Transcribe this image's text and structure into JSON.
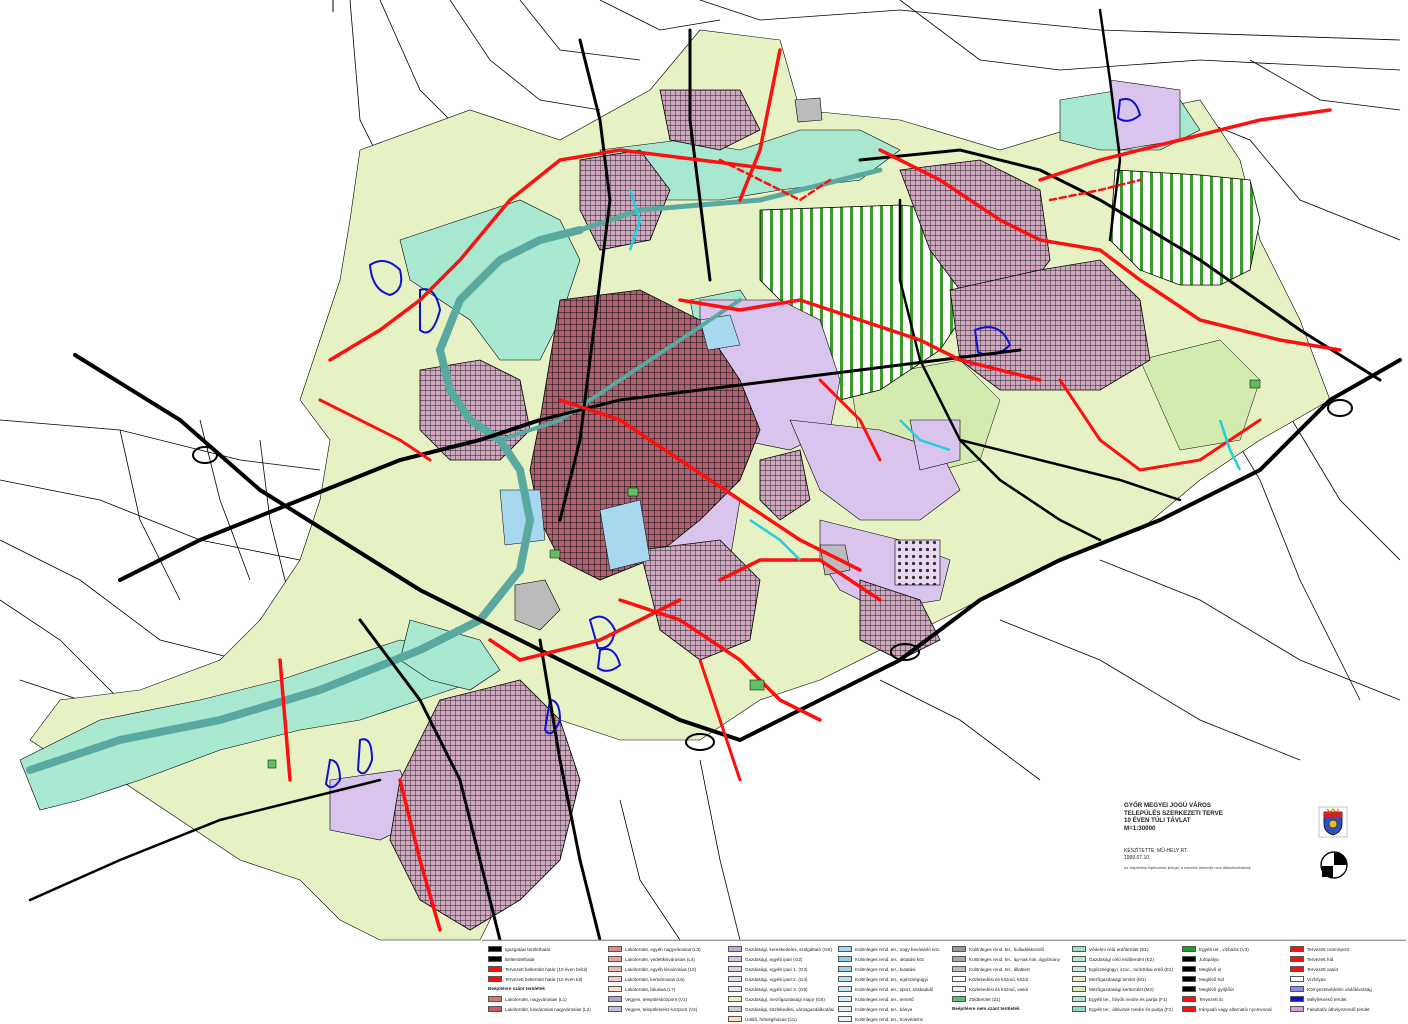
{
  "title": {
    "lines": [
      "GYŐR MEGYEI JOGÚ VÁROS",
      "TELEPÜLÉS SZERKEZETI TERVE",
      "10 ÉVEN TÚLI TÁVLAT",
      "M=1:30000"
    ],
    "maker": "KÉSZÍTETTE: MŰ-HELY RT.",
    "date": "1999.07.10.",
    "note": "Az alaptérkép tájékoztató jellegű, a méretek átmérője nem állandósíthatóak"
  },
  "colors": {
    "residential": "#e8a0a8",
    "residential_dark": "#c8606a",
    "mixed": "#c9b8e8",
    "industry": "#d8c4ec",
    "green": "#9fe0c0",
    "water_zone": "#a8e8d0",
    "agri": "#e6f2c4",
    "agri_dark": "#d4ebb0",
    "forest_stripe": "#3a9a2a",
    "road_plan": "#ff1010",
    "road": "#000000",
    "river": "#5aa9a0",
    "boundary_blue": "#1010d0",
    "special": "#a8d8f0"
  },
  "legend": {
    "col1": [
      {
        "label": "Igazgatási területhatár",
        "swatch": "#000000"
      },
      {
        "label": "Belterülethatár",
        "swatch": "#000000"
      },
      {
        "label": "Tervezett belterület határ (10 éven belül)",
        "swatch": "#ff1010"
      },
      {
        "label": "Tervezett belterület határ (10 éven túl)",
        "swatch": "#ff1010"
      }
    ],
    "col1_head": "Beépítésre szánt területek",
    "col1b": [
      {
        "label": "Lakóterület, nagyvárosias (L1)",
        "swatch": "#e07078"
      },
      {
        "label": "Lakóterület, kisvárosias nagyvárosias (L2)",
        "swatch": "#d05860"
      }
    ],
    "col2": [
      {
        "label": "Lakóterület, egyéb nagyvárosias (L3)",
        "swatch": "#e88888"
      },
      {
        "label": "Lakóterület, védettkisvárosias (L4)",
        "swatch": "#f0a0a0"
      },
      {
        "label": "Lakóterület, egyéb kisvárosias (L5)",
        "swatch": "#f4b4b4"
      },
      {
        "label": "Lakóterület, kertvárosias (L6)",
        "swatch": "#f8c8c8"
      },
      {
        "label": "Lakóterület, falusias (L7)",
        "swatch": "#fce0c8"
      },
      {
        "label": "Vegyes, településközpont (V1)",
        "swatch": "#b0a0d8"
      },
      {
        "label": "Vegyes, településrész-központ (V2)",
        "swatch": "#c4b8e4"
      }
    ],
    "col3": [
      {
        "label": "Gazdasági, kereskedelmi, szolgáltató (GK)",
        "swatch": "#c8a8e0"
      },
      {
        "label": "Gazdasági, egyéb ipari (G2)",
        "swatch": "#d8c0ec"
      },
      {
        "label": "Gazdasági, egyéb ipari 1. (G3)",
        "swatch": "#e0ccf0"
      },
      {
        "label": "Gazdasági, egyéb ipari 2. (G4)",
        "swatch": "#e8d8f4"
      },
      {
        "label": "Gazdasági, egyéb ipari 3. (G5)",
        "swatch": "#f0e4f8"
      },
      {
        "label": "Gazdasági, mezőgazdasági major (G6)",
        "swatch": "#e6f2c4"
      },
      {
        "label": "Gazdasági, közlekedési, városgazdálkodási",
        "swatch": "#cccccc"
      },
      {
        "label": "Üdülő, hétvégiházas (Ü1)",
        "swatch": "#f8e8b0"
      }
    ],
    "col4": [
      {
        "label": "Különleges rend. ter., nagy bevásárló köz.",
        "swatch": "#a8d8f0"
      },
      {
        "label": "Különleges rend. ter., oktatási köz.",
        "swatch": "#90ccf0"
      },
      {
        "label": "Különleges rend. ter., kutatási",
        "swatch": "#a0d0e8"
      },
      {
        "label": "Különleges rend. ter., egészségügyi",
        "swatch": "#b8e0f0"
      },
      {
        "label": "Különleges rend. ter., sport, szabadidő",
        "swatch": "#c8e8f4"
      },
      {
        "label": "Különleges rend. ter., temető",
        "swatch": "#d0ecf8"
      },
      {
        "label": "Különleges rend. ter., bánya",
        "swatch": "#e0f0f8"
      },
      {
        "label": "Különleges rend. ter., honvédelmi",
        "swatch": "#e8f4fa"
      }
    ],
    "col5": [
      {
        "label": "Különleges rend. ter., hulladékkezelő",
        "swatch": "#999999"
      },
      {
        "label": "Különleges rend. ter., ág-nak min. ágyitmány",
        "swatch": "#aaaaaa"
      },
      {
        "label": "Különleges rend. ter., állatkert",
        "swatch": "#bbbbbb"
      },
      {
        "label": "Közlekedési és közmű, közút",
        "swatch": "#ffffff"
      },
      {
        "label": "Közlekedési és közmű, vasút",
        "swatch": "#eeeeee"
      },
      {
        "label": "Zöldterület (Z1)",
        "swatch": "#60c060"
      }
    ],
    "col5_head": "Beépítésre nem szánt területek",
    "col6": [
      {
        "label": "Védelmi célú erdőterület (E1)",
        "swatch": "#9fe0c0"
      },
      {
        "label": "Gazdasági célú erdőterület (E2)",
        "swatch": "#b0e8d0"
      },
      {
        "label": "Egészségügyi, szoc., turisztikai erdő (E3)",
        "swatch": "#c0ecd8"
      },
      {
        "label": "Mezőgazdasági terület (M1)",
        "swatch": "#e6f2c4"
      },
      {
        "label": "Mezőgazdasági kertterület (M2)",
        "swatch": "#d4ebb0"
      },
      {
        "label": "Egyéb ter., folyók medre és partja (F1)",
        "swatch": "#a8e8d0"
      },
      {
        "label": "Egyéb ter., állóvizek medre és partja (F2)",
        "swatch": "#88d8c0"
      }
    ],
    "col7": [
      {
        "label": "Egyéb ter., vízbázis (V3)",
        "swatch": "#20a020"
      },
      {
        "label": "Jutópálya",
        "swatch": "#000000"
      },
      {
        "label": "Meglévő út",
        "swatch": "#000000"
      },
      {
        "label": "Meglévő híd",
        "swatch": "#000000"
      },
      {
        "label": "Meglévő gyűjtőút",
        "swatch": "#000000"
      },
      {
        "label": "Tervezett út",
        "swatch": "#ff1010"
      },
      {
        "label": "Irányadó vagy alternatív nyomvonal",
        "swatch": "#ff1010"
      }
    ],
    "col8": [
      {
        "label": "Tervezett csomópont",
        "swatch": "#ff1010"
      },
      {
        "label": "Tervezett híd",
        "swatch": "#ff1010"
      },
      {
        "label": "Tervezett vasút",
        "swatch": "#ff1010"
      },
      {
        "label": "Vízfolyás",
        "swatch": "#ffffff"
      },
      {
        "label": "Környezetvédelmi védőtávolság",
        "swatch": "#8888ff"
      },
      {
        "label": "Mélyfekvésű terület",
        "swatch": "#1010d0"
      },
      {
        "label": "Fakultatív áthelyezendő terület",
        "swatch": "#d0a0d0"
      }
    ]
  }
}
